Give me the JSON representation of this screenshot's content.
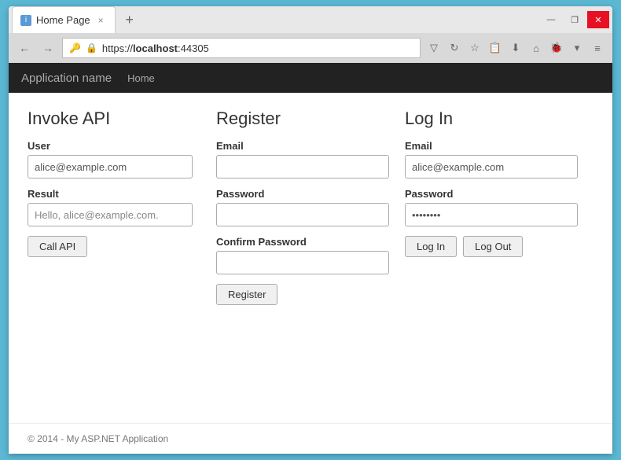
{
  "browser": {
    "tab_title": "Home Page",
    "tab_close": "×",
    "new_tab": "+",
    "address": "https://",
    "address_bold": "localhost",
    "address_port": ":44305",
    "win_minimize": "—",
    "win_restore": "❐",
    "win_close": "✕"
  },
  "navbar": {
    "app_name": "Application name",
    "nav_home": "Home"
  },
  "invoke_api": {
    "title": "Invoke API",
    "user_label": "User",
    "user_value": "alice@example.com",
    "result_label": "Result",
    "result_value": "Hello, alice@example.com.",
    "call_btn": "Call API"
  },
  "register": {
    "title": "Register",
    "email_label": "Email",
    "email_value": "",
    "email_placeholder": "",
    "password_label": "Password",
    "password_value": "",
    "confirm_label": "Confirm Password",
    "confirm_value": "",
    "register_btn": "Register"
  },
  "login": {
    "title": "Log In",
    "email_label": "Email",
    "email_value": "alice@example.com",
    "password_label": "Password",
    "password_value": "••••••••",
    "login_btn": "Log In",
    "logout_btn": "Log Out"
  },
  "footer": {
    "text": "© 2014 - My ASP.NET Application"
  }
}
